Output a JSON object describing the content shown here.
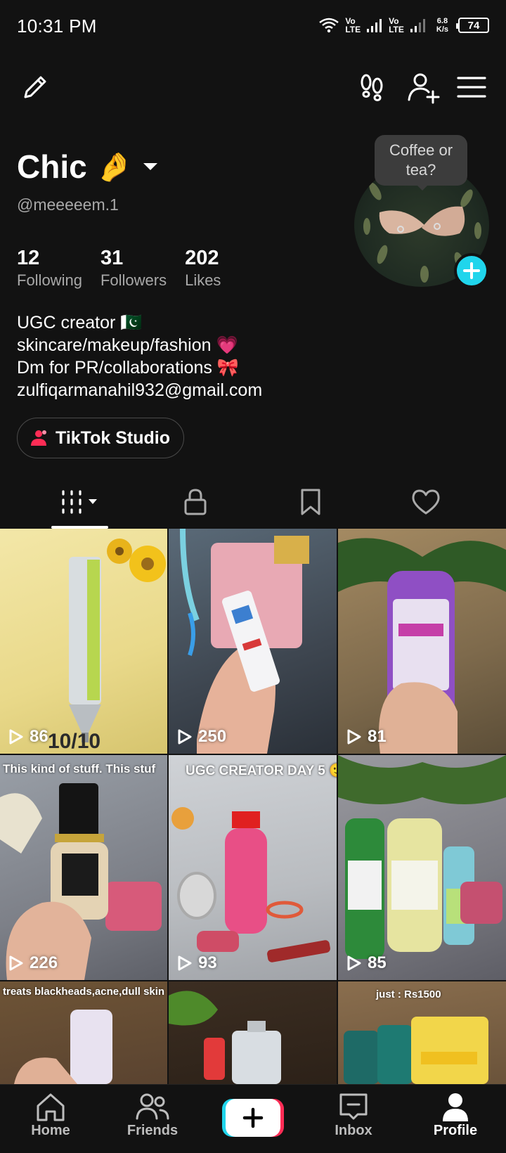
{
  "status_bar": {
    "time": "10:31 PM",
    "sim1": {
      "top": "Vo",
      "bottom": "LTE"
    },
    "sim2": {
      "top": "Vo",
      "bottom": "LTE"
    },
    "net_speed_value": "6.8",
    "net_speed_unit": "K/s",
    "battery": "74"
  },
  "top_bar": {
    "edit_icon": "pencil-icon",
    "footprint_icon": "footprints-icon",
    "add_friend_icon": "add-user-icon",
    "menu_icon": "hamburger-icon"
  },
  "profile": {
    "name": "Chic",
    "name_emoji": "🤌",
    "handle": "@meeeeem.1",
    "avatar_tooltip": "Coffee or tea?",
    "stats": [
      {
        "value": "12",
        "label": "Following"
      },
      {
        "value": "31",
        "label": "Followers"
      },
      {
        "value": "202",
        "label": "Likes"
      }
    ],
    "bio": [
      "UGC creator 🇵🇰",
      "skincare/makeup/fashion 💗",
      "Dm for PR/collaborations 🎀",
      "zulfiqarmanahil932@gmail.com"
    ],
    "studio_button": "TikTok Studio"
  },
  "tabs": [
    {
      "icon": "grid-icon",
      "active": true
    },
    {
      "icon": "lock-icon",
      "active": false
    },
    {
      "icon": "bookmark-icon",
      "active": false
    },
    {
      "icon": "heart-icon",
      "active": false
    }
  ],
  "videos": [
    {
      "views": "86",
      "caption": "10/10"
    },
    {
      "views": "250",
      "caption": ""
    },
    {
      "views": "81",
      "caption": ""
    },
    {
      "views": "226",
      "caption": "This kind of stuff. This stuf"
    },
    {
      "views": "93",
      "caption": "UGC CREATOR DAY 5 🙂✨"
    },
    {
      "views": "85",
      "caption": ""
    },
    {
      "views": "",
      "caption": "treats blackheads,acne,dull skin"
    },
    {
      "views": "",
      "caption": ""
    },
    {
      "views": "",
      "caption": "just : Rs1500"
    }
  ],
  "bottom_nav": {
    "home": "Home",
    "friends": "Friends",
    "inbox": "Inbox",
    "profile": "Profile"
  },
  "colors": {
    "background": "#121212",
    "accent_cyan": "#20d5ec",
    "accent_pink": "#fe2c55",
    "muted_text": "#a8a8a8"
  }
}
